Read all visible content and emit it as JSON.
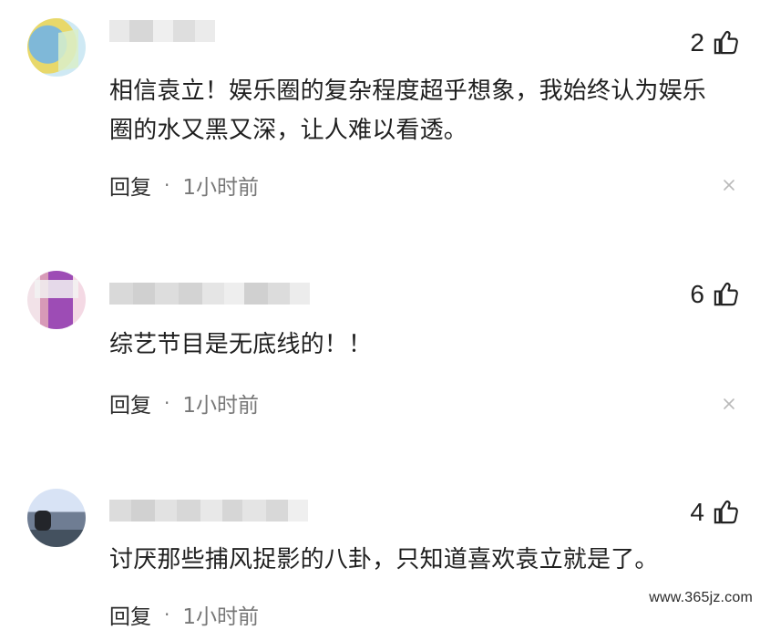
{
  "comments": [
    {
      "likes": "2",
      "text": "相信袁立！娱乐圈的复杂程度超乎想象，我始终认为娱乐\n圈的水又黑又深，让人难以看透。",
      "reply_label": "回复",
      "time": "1小时前"
    },
    {
      "likes": "6",
      "text": "综艺节目是无底线的！！",
      "reply_label": "回复",
      "time": "1小时前"
    },
    {
      "likes": "4",
      "text": "讨厌那些捕风捉影的八卦，只知道喜欢袁立就是了。",
      "reply_label": "回复",
      "time": "1小时前"
    }
  ],
  "watermark": "www.365jz.com",
  "icons": {
    "thumb": "thumb-up-icon",
    "close": "close-icon"
  },
  "colors": {
    "text": "#1f1f1f",
    "meta": "#777777",
    "blur": "#d9d9d9"
  }
}
